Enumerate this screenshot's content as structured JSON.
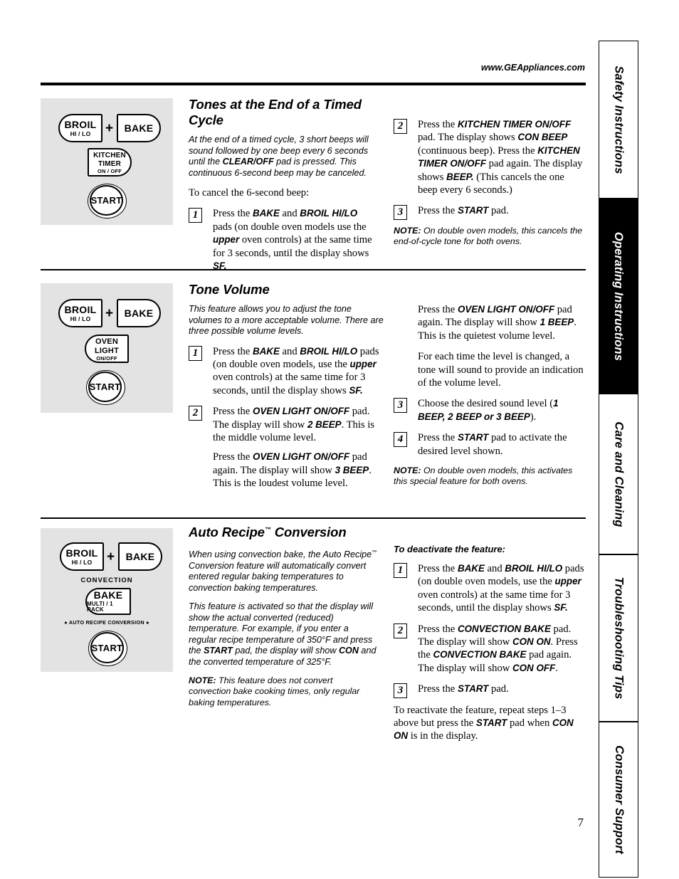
{
  "header": {
    "site_url": "www.GEAppliances.com"
  },
  "page_number": "7",
  "side_tabs": [
    {
      "label": "Safety Instructions",
      "active": false
    },
    {
      "label": "Operating Instructions",
      "active": true
    },
    {
      "label": "Care and Cleaning",
      "active": false
    },
    {
      "label": "Troubleshooting Tips",
      "active": false
    },
    {
      "label": "Consumer Support",
      "active": false
    }
  ],
  "sections": [
    {
      "id": "tones-end-of-timed-cycle",
      "title": "Tones at the End of a Timed Cycle",
      "intro": "At the end of a timed cycle, 3 short beeps will sound followed by one beep every 6 seconds until the CLEAR/OFF pad is pressed. This continuous 6-second beep may be canceled.",
      "intro_bold": "CLEAR/OFF",
      "lead": "To cancel the 6-second beep:",
      "pads": {
        "pad1": {
          "l1": "BROIL",
          "l2": "HI / LO"
        },
        "plus": "+",
        "pad2": {
          "l1": "BAKE"
        },
        "pad3": {
          "l1": "KITCHEN",
          "l2": "TIMER",
          "l3": "ON / OFF"
        },
        "start": "START"
      },
      "steps_left": [
        {
          "num": "1",
          "text": "Press the BAKE and BROIL HI/LO pads (on double oven models use the upper oven controls) at the same time for 3 seconds, until the display shows SF."
        }
      ],
      "steps_right": [
        {
          "num": "2",
          "text": "Press the KITCHEN TIMER ON/OFF pad. The display shows CON BEEP (continuous beep). Press the KITCHEN TIMER ON/OFF pad again. The display shows BEEP. (This cancels the one beep every 6 seconds.)"
        },
        {
          "num": "3",
          "text": "Press the START pad."
        }
      ],
      "note_label": "NOTE:",
      "note": "On double oven models, this cancels the end-of-cycle tone for both ovens."
    },
    {
      "id": "tone-volume",
      "title": "Tone Volume",
      "intro": "This feature allows you to adjust the tone volumes to a more acceptable volume. There are three possible volume levels.",
      "pads": {
        "pad1": {
          "l1": "BROIL",
          "l2": "HI / LO"
        },
        "plus": "+",
        "pad2": {
          "l1": "BAKE"
        },
        "pad3": {
          "l1": "OVEN",
          "l2": "LIGHT",
          "l3": "ON/OFF"
        },
        "start": "START"
      },
      "steps_left": [
        {
          "num": "1",
          "text": "Press the BAKE and BROIL HI/LO pads (on double oven models, use the upper oven controls) at the same time for 3 seconds, until the display shows SF."
        },
        {
          "num": "2",
          "text": "Press the OVEN LIGHT ON/OFF pad. The display will show 2 BEEP. This is the middle volume level.",
          "text2": "Press the OVEN LIGHT ON/OFF pad again. The display will show 3 BEEP. This is the loudest volume level."
        }
      ],
      "steps_right": [
        {
          "num": "",
          "text": "Press the OVEN LIGHT ON/OFF pad again. The display will show 1 BEEP. This is the quietest volume level.",
          "text2": "For each time the level is changed, a tone will sound to provide an indication of the volume level."
        },
        {
          "num": "3",
          "text": "Choose the desired sound level (1 BEEP, 2 BEEP or 3 BEEP)."
        },
        {
          "num": "4",
          "text": "Press the START pad to activate the desired level shown."
        }
      ],
      "note_label": "NOTE:",
      "note": "On double oven models, this activates this special feature for both ovens."
    },
    {
      "id": "auto-recipe-conversion",
      "title": "Auto Recipe™ Conversion",
      "intro": "When using convection bake, the Auto Recipe™ Conversion feature will automatically convert entered regular baking temperatures to convection baking temperatures.",
      "intro2": "This feature is activated so that the display will show the actual converted (reduced) temperature. For example, if you enter a regular recipe temperature of 350°F and press the START pad, the display will show CON and the converted temperature of 325°F.",
      "pads": {
        "pad1": {
          "l1": "BROIL",
          "l2": "HI / LO"
        },
        "plus": "+",
        "pad2": {
          "l1": "BAKE"
        },
        "convection_label": "CONVECTION",
        "pad3": {
          "l1": "BAKE",
          "l2": "MULTI / 1 RACK"
        },
        "arc_label": "● AUTO RECIPE CONVERSION ●",
        "start": "START"
      },
      "note_label": "NOTE:",
      "note": "This feature does not convert convection bake cooking times, only regular baking temperatures.",
      "subhead_right": "To deactivate the feature:",
      "steps_right": [
        {
          "num": "1",
          "text": "Press the BAKE and BROIL HI/LO pads (on double oven models, use the upper oven controls) at the same time for 3 seconds, until the display shows SF."
        },
        {
          "num": "2",
          "text": "Press the CONVECTION BAKE pad. The display will show CON ON. Press the CONVECTION BAKE pad again. The display will show CON OFF."
        },
        {
          "num": "3",
          "text": "Press the START pad."
        }
      ],
      "closing": "To reactivate the feature, repeat steps 1–3 above but press the START pad when CON ON is in the display."
    }
  ]
}
